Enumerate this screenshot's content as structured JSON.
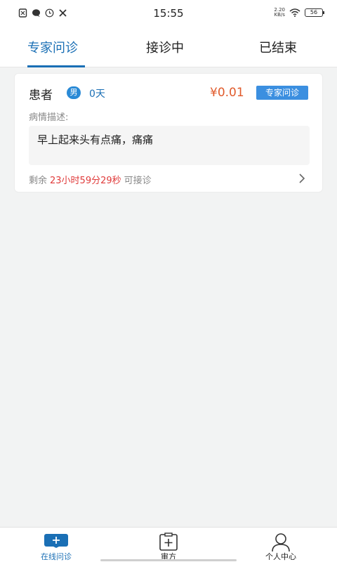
{
  "status_bar": {
    "time": "15:55",
    "net_speed_value": "2.20",
    "net_speed_unit": "KB/s",
    "battery": "56",
    "left_icons": [
      "sim-icon",
      "chat-icon",
      "clock-icon",
      "tools-icon"
    ]
  },
  "tabs": [
    {
      "label": "专家问诊",
      "active": true
    },
    {
      "label": "接诊中",
      "active": false
    },
    {
      "label": "已结束",
      "active": false
    }
  ],
  "card": {
    "patient_name": "患者",
    "gender": "男",
    "age": "0天",
    "price": "¥0.01",
    "type_badge": "专家问诊",
    "desc_label": "病情描述:",
    "description": "早上起来头有点痛，痛痛",
    "remaining_prefix": "剩余",
    "countdown": "23小时59分29秒",
    "remaining_suffix": "可接诊"
  },
  "bottom_nav": [
    {
      "label": "在线问诊",
      "icon": "plus-square-icon",
      "active": true
    },
    {
      "label": "审方",
      "icon": "clipboard-icon",
      "active": false
    },
    {
      "label": "个人中心",
      "icon": "person-icon",
      "active": false
    }
  ],
  "colors": {
    "accent": "#1a6fb5",
    "price": "#e05a2b",
    "countdown": "#e03b3b",
    "badge": "#3b8fe0",
    "background": "#f2f3f3"
  }
}
